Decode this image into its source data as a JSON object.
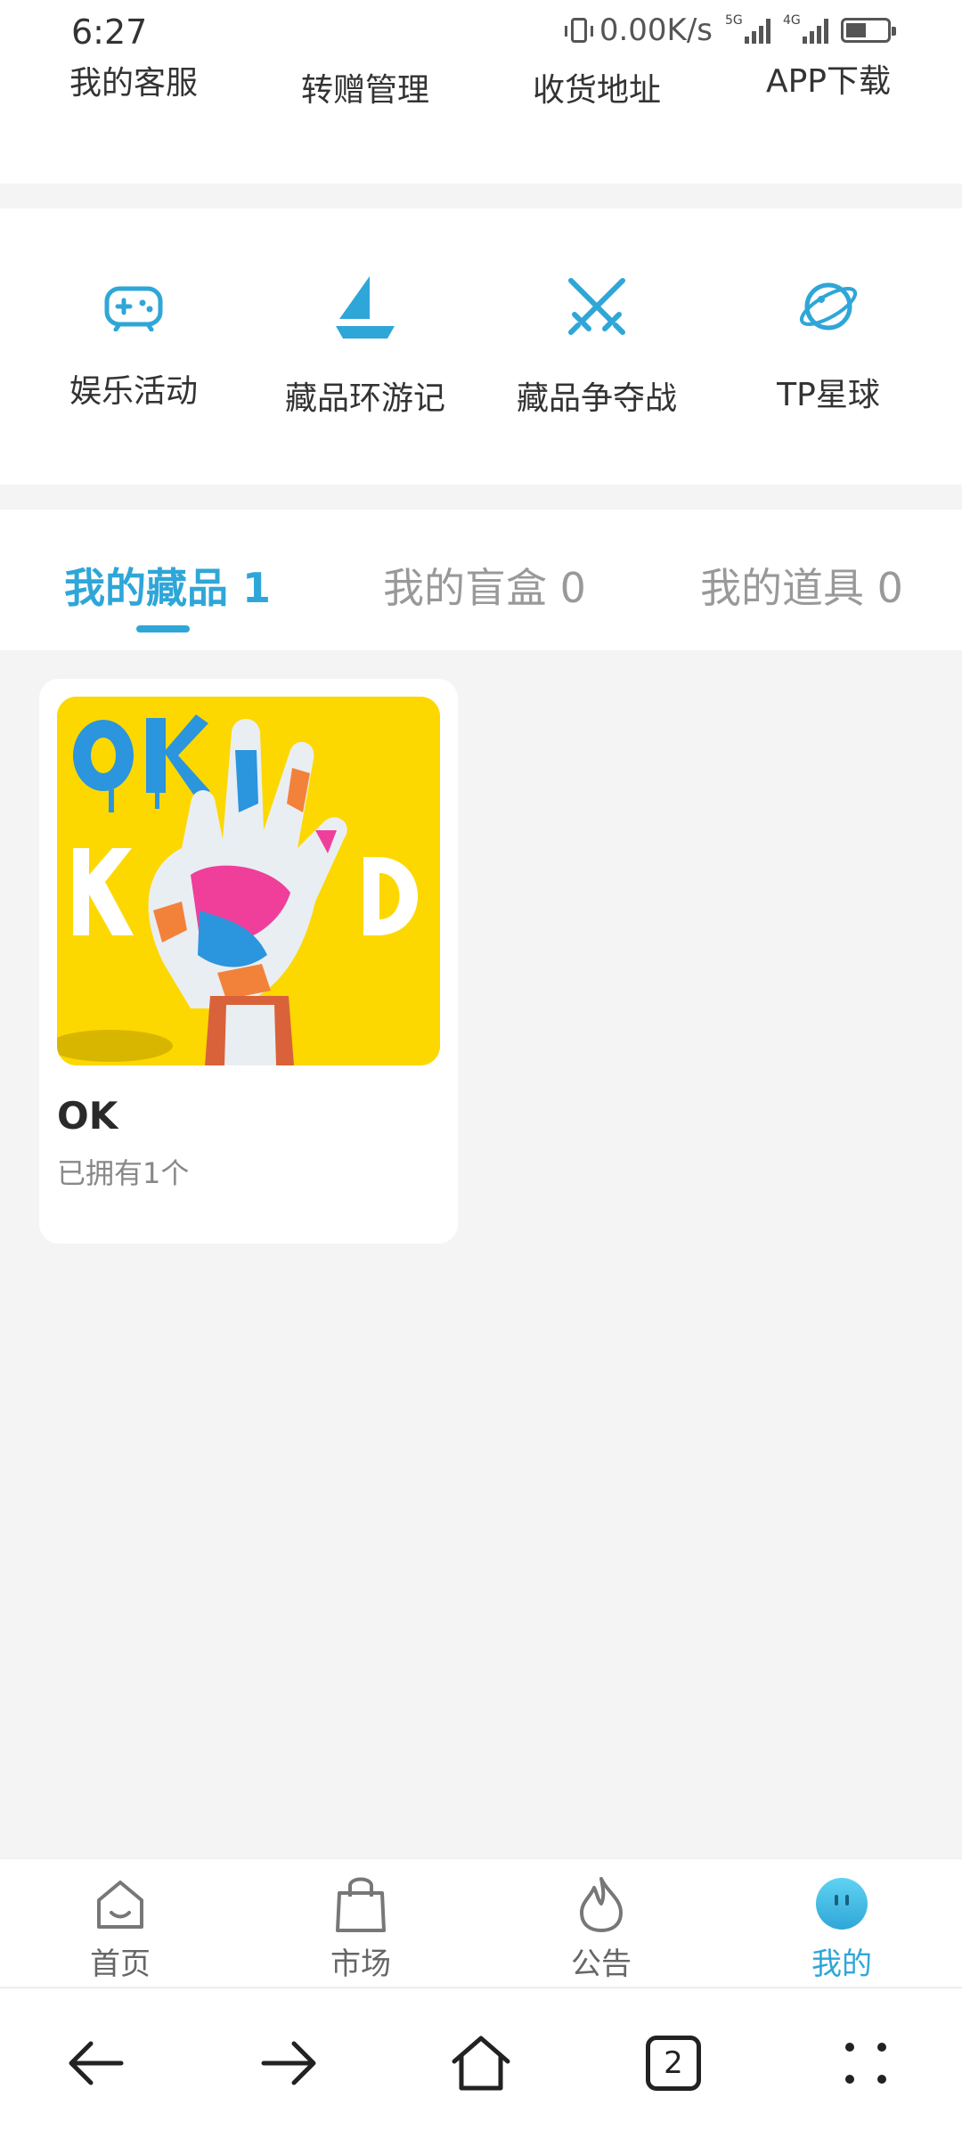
{
  "status_bar": {
    "time": "6:27",
    "net_speed": "0.00K/s",
    "sim1_label": "5G",
    "sim2_label": "4G"
  },
  "quick_links": [
    "我的客服",
    "转赠管理",
    "收货地址",
    "APP下载"
  ],
  "features": [
    {
      "label": "娱乐活动",
      "icon": "gamepad-icon"
    },
    {
      "label": "藏品环游记",
      "icon": "sailboat-icon"
    },
    {
      "label": "藏品争夺战",
      "icon": "crossed-swords-icon"
    },
    {
      "label": "TP星球",
      "icon": "planet-icon"
    }
  ],
  "tabs": [
    {
      "label": "我的藏品 1",
      "active": true
    },
    {
      "label": "我的盲盒 0",
      "active": false
    },
    {
      "label": "我的道具 0",
      "active": false
    }
  ],
  "collection": [
    {
      "name": "OK",
      "owned": "已拥有1个",
      "image": "ok-hand-artwork"
    }
  ],
  "bottom_tabs": [
    {
      "label": "首页",
      "icon": "home-icon"
    },
    {
      "label": "市场",
      "icon": "shopping-bag-icon"
    },
    {
      "label": "公告",
      "icon": "flame-icon"
    },
    {
      "label": "我的",
      "icon": "profile-avatar-icon",
      "active": true
    }
  ],
  "nav_bar": {
    "tab_count": "2"
  },
  "colors": {
    "accent": "#2fa6d8",
    "background": "#f4f4f4",
    "card_image_bg": "#fcd800"
  }
}
